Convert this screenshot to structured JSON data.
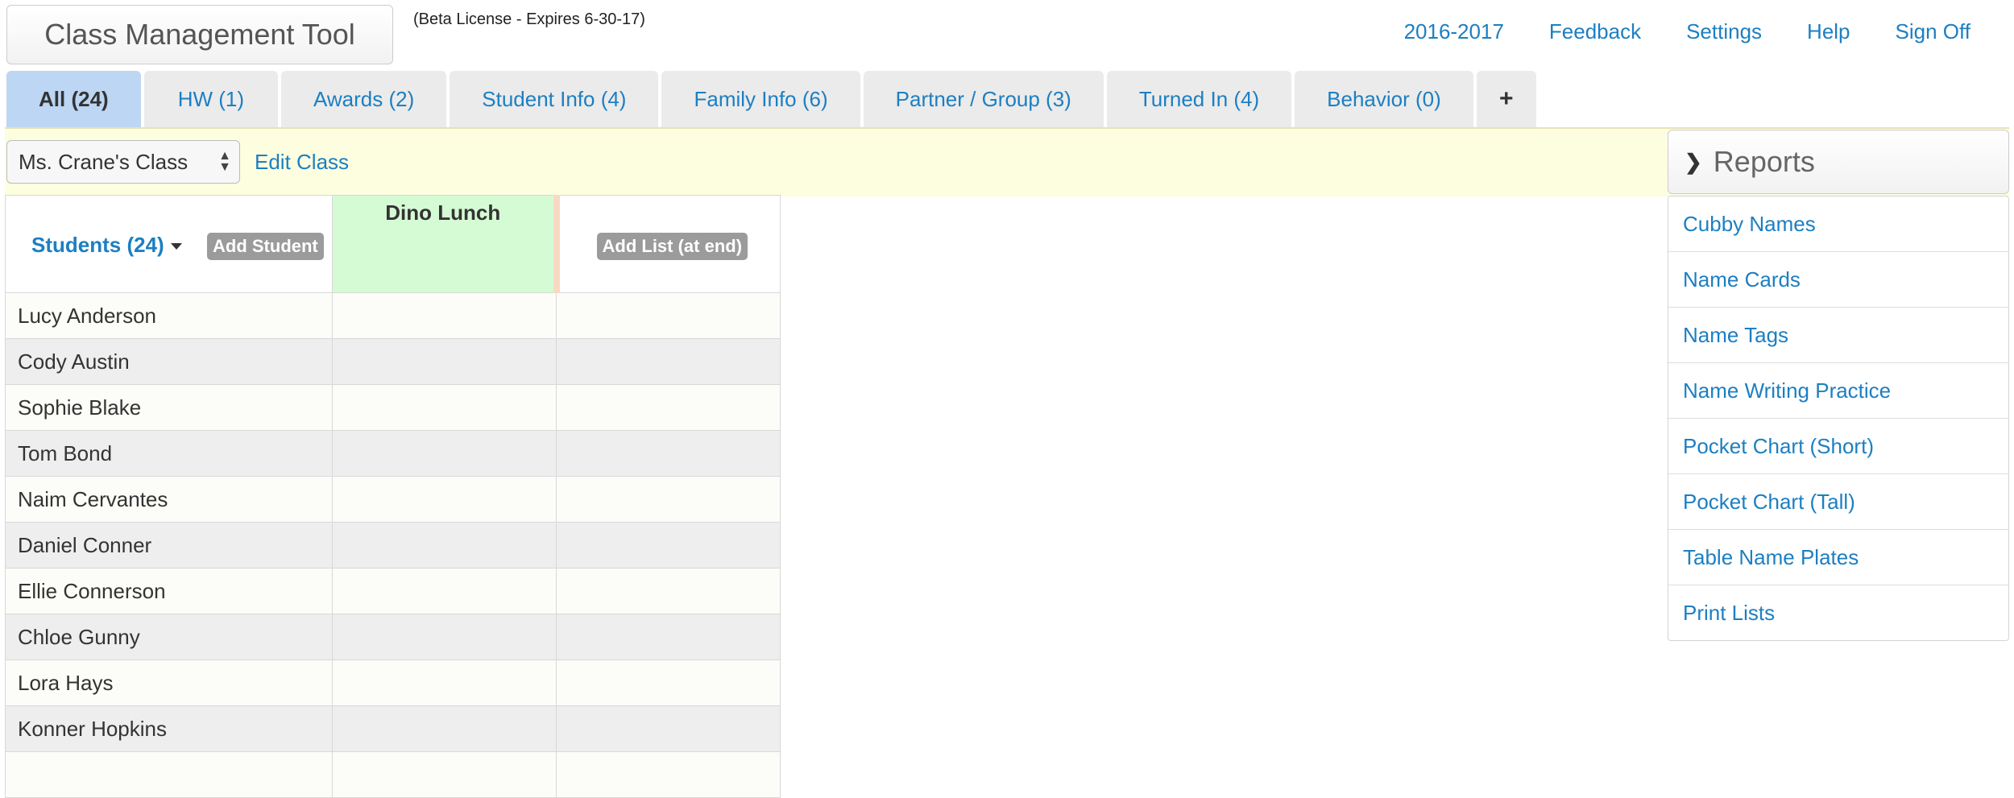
{
  "header": {
    "app_title": "Class Management Tool",
    "license": "(Beta License - Expires 6-30-17)",
    "nav": [
      "2016-2017",
      "Feedback",
      "Settings",
      "Help",
      "Sign Off"
    ]
  },
  "tabs": [
    {
      "label": "All (24)",
      "active": true
    },
    {
      "label": "HW (1)"
    },
    {
      "label": "Awards (2)"
    },
    {
      "label": "Student Info (4)"
    },
    {
      "label": "Family Info (6)"
    },
    {
      "label": "Partner / Group (3)"
    },
    {
      "label": "Turned In (4)"
    },
    {
      "label": "Behavior (0)"
    },
    {
      "label": "+",
      "icon": "plus-icon"
    }
  ],
  "classbar": {
    "selected_class": "Ms. Crane's Class",
    "edit_label": "Edit Class"
  },
  "table": {
    "students_header": "Students (24)",
    "add_student": "Add Student",
    "list_name": "Dino Lunch",
    "add_list": "Add List (at end)",
    "students": [
      "Lucy Anderson",
      "Cody Austin",
      "Sophie Blake",
      "Tom Bond",
      "Naim Cervantes",
      "Daniel Conner",
      "Ellie Connerson",
      "Chloe Gunny",
      "Lora Hays",
      "Konner Hopkins"
    ]
  },
  "reports": {
    "title": "Reports",
    "items": [
      "Cubby Names",
      "Name Cards",
      "Name Tags",
      "Name Writing Practice",
      "Pocket Chart (Short)",
      "Pocket Chart (Tall)",
      "Table Name Plates",
      "Print Lists"
    ]
  },
  "colors": {
    "link": "#1c7fc2",
    "active_tab": "#bcd6f3",
    "classbar_bg": "#fdfde0",
    "list_column": "#d5fbd5"
  }
}
